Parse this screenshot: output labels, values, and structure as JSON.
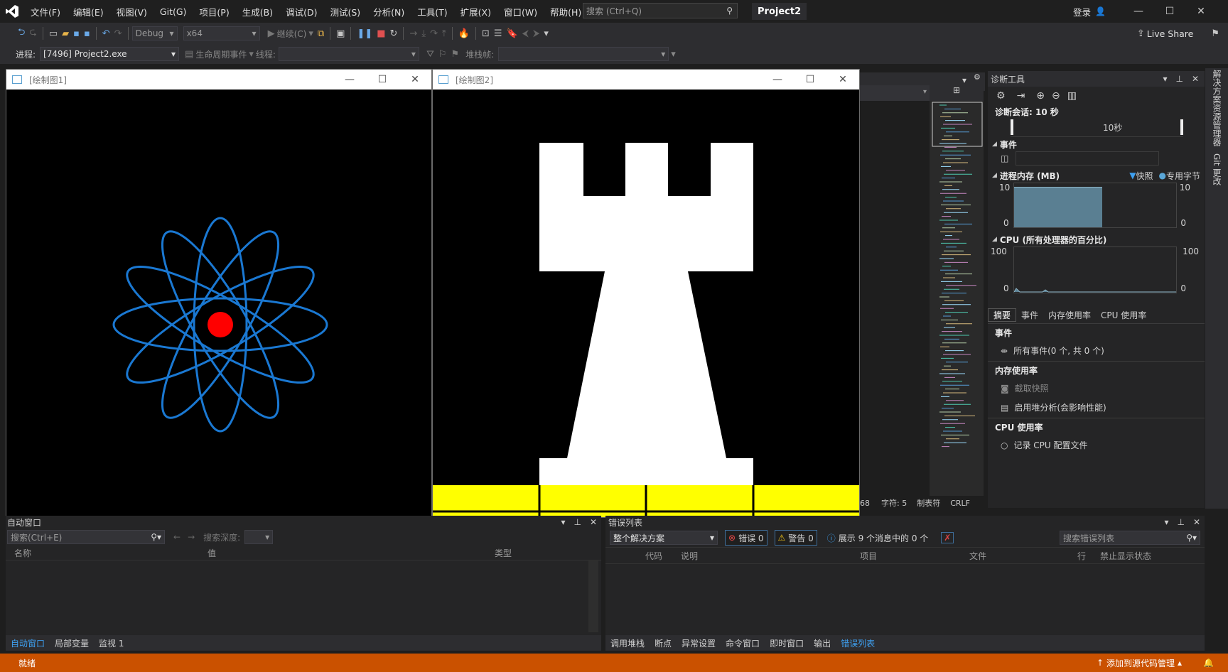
{
  "titlebar": {
    "menu": [
      "文件(F)",
      "编辑(E)",
      "视图(V)",
      "Git(G)",
      "项目(P)",
      "生成(B)",
      "调试(D)",
      "测试(S)",
      "分析(N)",
      "工具(T)",
      "扩展(X)",
      "窗口(W)",
      "帮助(H)"
    ],
    "search_placeholder": "搜索 (Ctrl+Q)",
    "project_name": "Project2",
    "login": "登录"
  },
  "toolbar": {
    "config": "Debug",
    "platform": "x64",
    "continue": "继续(C)",
    "live_share": "Live Share"
  },
  "debugbar": {
    "process_label": "进程:",
    "process_value": "[7496] Project2.exe",
    "lifecycle": "生命周期事件",
    "thread_label": "线程:",
    "stackframe_label": "堆栈帧:"
  },
  "window1": {
    "title": "[绘制图1]"
  },
  "window2": {
    "title": "[绘制图2]"
  },
  "editor_status": {
    "line_col": "68",
    "chars": "字符: 5",
    "tab": "制表符",
    "eol": "CRLF"
  },
  "diagnostics": {
    "title": "诊断工具",
    "session": "诊断会话: 10 秒",
    "timeline_label": "10秒",
    "events_header": "事件",
    "memory_header": "进程内存 (MB)",
    "snapshot_legend": "快照",
    "private_bytes_legend": "专用字节",
    "mem_ymax": "10",
    "mem_ymin": "0",
    "cpu_header": "CPU (所有处理器的百分比)",
    "cpu_ymax": "100",
    "cpu_ymin": "0",
    "tabs": [
      "摘要",
      "事件",
      "内存使用率",
      "CPU 使用率"
    ],
    "sec_events": "事件",
    "all_events": "所有事件(0 个, 共 0 个)",
    "sec_memory": "内存使用率",
    "take_snapshot": "截取快照",
    "heap_profile": "启用堆分析(会影响性能)",
    "sec_cpu": "CPU 使用率",
    "record_cpu": "记录 CPU 配置文件",
    "memory_level": 1.0,
    "colors": {
      "memory_fill": "#5a7f92",
      "snapshot": "#3ea0f0"
    }
  },
  "side_tabs": [
    "解决方案资源管理器",
    "Git 更改"
  ],
  "autos": {
    "title": "自动窗口",
    "search_placeholder": "搜索(Ctrl+E)",
    "search_depth": "搜索深度:",
    "columns": [
      "名称",
      "值",
      "类型"
    ],
    "tabs": [
      "自动窗口",
      "局部变量",
      "监视 1"
    ]
  },
  "errors": {
    "title": "错误列表",
    "scope": "整个解决方案",
    "errors_btn": "错误 0",
    "warnings_btn": "警告 0",
    "messages_btn": "展示 9 个消息中的 0 个",
    "search_placeholder": "搜索错误列表",
    "columns": [
      "代码",
      "说明",
      "项目",
      "文件",
      "行",
      "禁止显示状态"
    ],
    "tabs": [
      "调用堆栈",
      "断点",
      "异常设置",
      "命令窗口",
      "即时窗口",
      "输出",
      "错误列表"
    ]
  },
  "statusbar": {
    "ready": "就绪",
    "source_control": "添加到源代码管理"
  },
  "colors": {
    "accent": "#3ea0f0",
    "status": "#ca5100",
    "atom": "#1a78d2",
    "nucleus": "#ff0000",
    "board": "#ffff00"
  }
}
